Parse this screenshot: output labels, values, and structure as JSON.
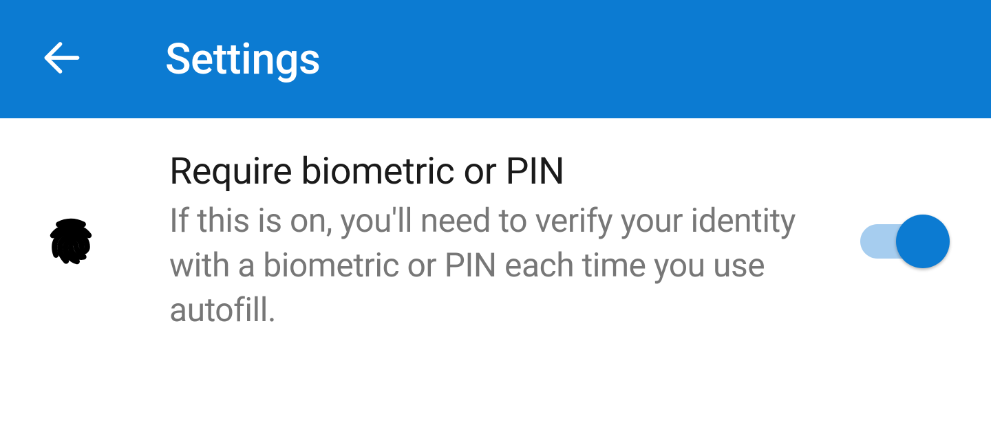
{
  "colors": {
    "primary": "#0c7bd2",
    "toggleTrack": "#a6cdef",
    "textPrimary": "#1a1a1a",
    "textSecondary": "#777777"
  },
  "header": {
    "title": "Settings"
  },
  "setting": {
    "title": "Require biometric or PIN",
    "description": "If this is on, you'll need to verify your identity with a biometric or PIN each time you use autofill.",
    "toggleState": "on"
  }
}
